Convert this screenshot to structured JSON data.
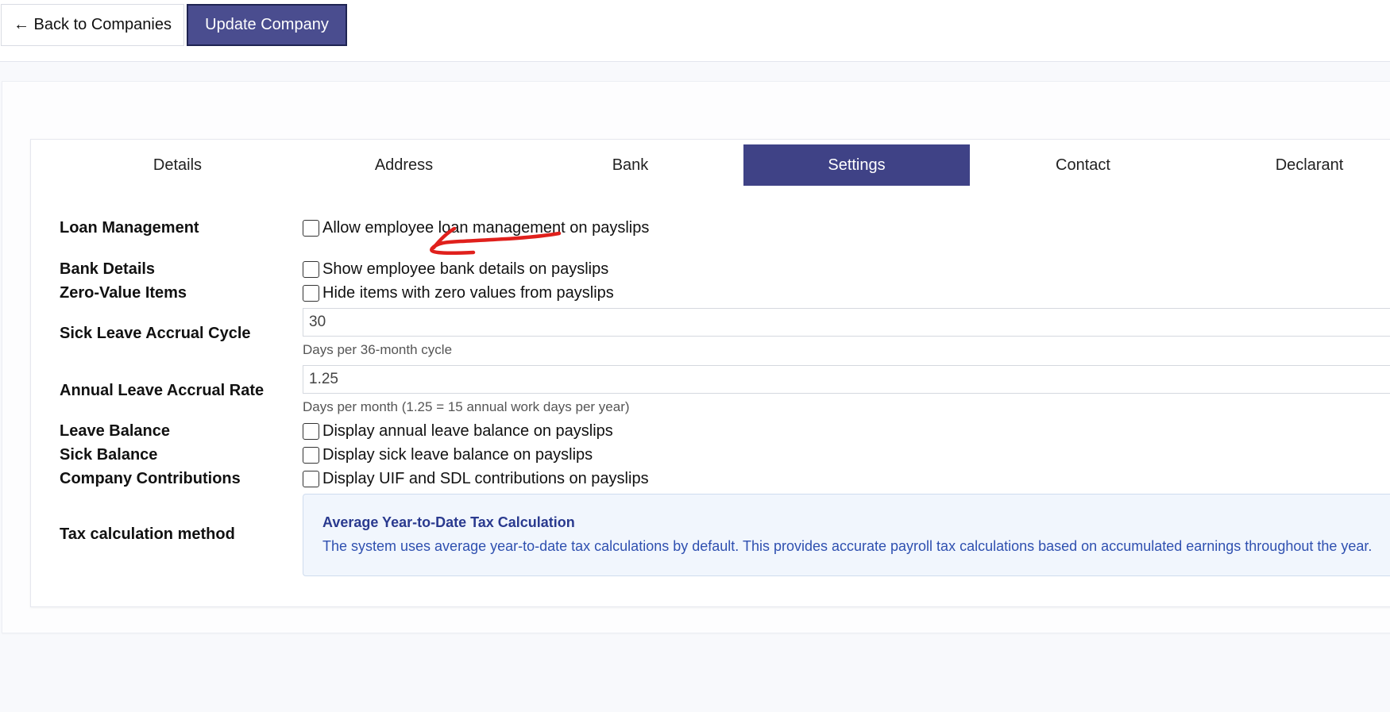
{
  "header": {
    "back_label": "← Back to Companies",
    "update_label": "Update Company"
  },
  "tabs": [
    {
      "label": "Details"
    },
    {
      "label": "Address"
    },
    {
      "label": "Bank"
    },
    {
      "label": "Settings"
    },
    {
      "label": "Contact"
    },
    {
      "label": "Declarant"
    }
  ],
  "settings": {
    "loan_management": {
      "label": "Loan Management",
      "checkbox_text": "Allow employee loan management on payslips",
      "checked": false
    },
    "bank_details": {
      "label": "Bank Details",
      "checkbox_text": "Show employee bank details on payslips",
      "checked": false
    },
    "zero_value_items": {
      "label": "Zero-Value Items",
      "checkbox_text": "Hide items with zero values from payslips",
      "checked": false
    },
    "sick_leave_accrual_cycle": {
      "label": "Sick Leave Accrual Cycle",
      "value": "30",
      "help": "Days per 36-month cycle"
    },
    "annual_leave_accrual_rate": {
      "label": "Annual Leave Accrual Rate",
      "value": "1.25",
      "help": "Days per month (1.25 = 15 annual work days per year)"
    },
    "leave_balance": {
      "label": "Leave Balance",
      "checkbox_text": "Display annual leave balance on payslips",
      "checked": false
    },
    "sick_balance": {
      "label": "Sick Balance",
      "checkbox_text": "Display sick leave balance on payslips",
      "checked": false
    },
    "company_contributions": {
      "label": "Company Contributions",
      "checkbox_text": "Display UIF and SDL contributions on payslips",
      "checked": false
    },
    "tax_calculation_method": {
      "label": "Tax calculation method",
      "info_title": "Average Year-to-Date Tax Calculation",
      "info_text": "The system uses average year-to-date tax calculations by default. This provides accurate payroll tax calculations based on accumulated earnings throughout the year."
    }
  },
  "colors": {
    "primary": "#4a4d8f",
    "active_tab": "#3f4286",
    "info_title": "#2a3a8f",
    "info_text": "#2f50b0",
    "annotation": "#e0201c"
  }
}
